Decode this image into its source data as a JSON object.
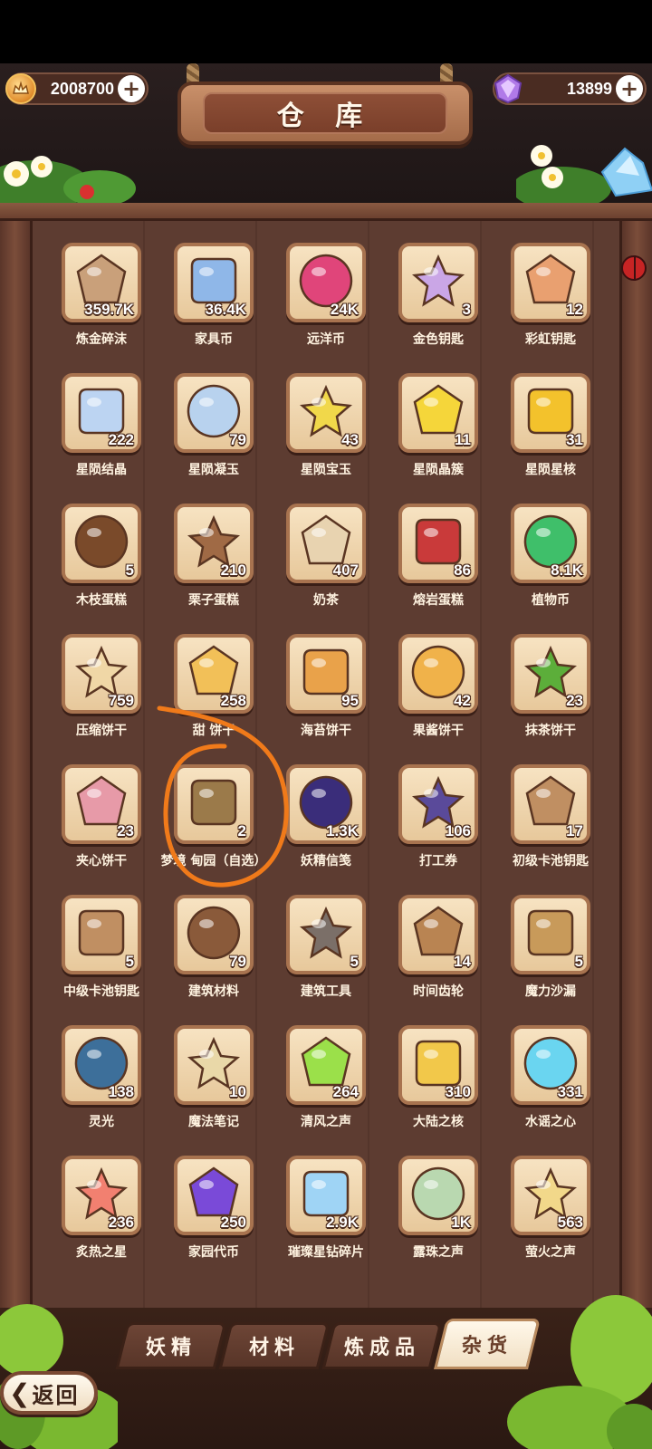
{
  "header": {
    "title": "仓 库",
    "gold": {
      "value": "2008700",
      "icon": "gold-coin-icon"
    },
    "gems": {
      "value": "13899",
      "icon": "gem-icon"
    }
  },
  "items": [
    {
      "name": "炼金碎沫",
      "count": "359.7K",
      "icon": "rock-pile-icon",
      "color": "#c9a07a"
    },
    {
      "name": "家具币",
      "count": "36.4K",
      "icon": "furniture-coin-icon",
      "color": "#8fb7e8"
    },
    {
      "name": "远洋币",
      "count": "24K",
      "icon": "ocean-coin-icon",
      "color": "#e0457a"
    },
    {
      "name": "金色钥匙",
      "count": "3",
      "icon": "golden-key-icon",
      "color": "#caa6e6"
    },
    {
      "name": "彩虹钥匙",
      "count": "12",
      "icon": "rainbow-key-icon",
      "color": "#e9a070"
    },
    {
      "name": "星陨结晶",
      "count": "222",
      "icon": "crystal-icon",
      "color": "#bcd4f2"
    },
    {
      "name": "星陨凝玉",
      "count": "79",
      "icon": "star-jade-icon",
      "color": "#b8d2ee"
    },
    {
      "name": "星陨宝玉",
      "count": "43",
      "icon": "yellow-gem-icon",
      "color": "#f1d84a"
    },
    {
      "name": "星陨晶簇",
      "count": "11",
      "icon": "yellow-star-icon",
      "color": "#f5d63a"
    },
    {
      "name": "星陨星核",
      "count": "31",
      "icon": "star-core-icon",
      "color": "#f3c22c"
    },
    {
      "name": "木枝蛋糕",
      "count": "5",
      "icon": "log-cake-icon",
      "color": "#7a4a2a"
    },
    {
      "name": "栗子蛋糕",
      "count": "210",
      "icon": "chestnut-cake-icon",
      "color": "#a06a45"
    },
    {
      "name": "奶茶",
      "count": "407",
      "icon": "milk-tea-icon",
      "color": "#e8d3b0"
    },
    {
      "name": "熔岩蛋糕",
      "count": "86",
      "icon": "lava-cake-icon",
      "color": "#c93a3a"
    },
    {
      "name": "植物币",
      "count": "8.1K",
      "icon": "plant-coin-icon",
      "color": "#3fbf6a"
    },
    {
      "name": "压缩饼干",
      "count": "759",
      "icon": "biscuit-cubes-icon",
      "color": "#f0d7a6"
    },
    {
      "name": "甜 饼干",
      "count": "258",
      "icon": "triangle-cracker-icon",
      "color": "#f2c058"
    },
    {
      "name": "海苔饼干",
      "count": "95",
      "icon": "seaweed-cracker-icon",
      "color": "#e9a24a"
    },
    {
      "name": "果酱饼干",
      "count": "42",
      "icon": "jam-cookie-icon",
      "color": "#f0b24a"
    },
    {
      "name": "抹茶饼干",
      "count": "23",
      "icon": "matcha-cookie-icon",
      "color": "#5cae3a"
    },
    {
      "name": "夹心饼干",
      "count": "23",
      "icon": "sandwich-cookie-icon",
      "color": "#e79aa8"
    },
    {
      "name": "梦境 甸园（自选）",
      "count": "2",
      "icon": "gift-box-icon",
      "color": "#9b7a4a"
    },
    {
      "name": "妖精信笺",
      "count": "1.3K",
      "icon": "fairy-card-icon",
      "color": "#3a2d7a"
    },
    {
      "name": "打工券",
      "count": "106",
      "icon": "work-ticket-icon",
      "color": "#5a4a9a"
    },
    {
      "name": "初级卡池钥匙",
      "count": "17",
      "icon": "bronze-key-icon",
      "color": "#c08f62"
    },
    {
      "name": "中级卡池钥匙",
      "count": "5",
      "icon": "silver-key-icon",
      "color": "#c08f62"
    },
    {
      "name": "建筑材料",
      "count": "79",
      "icon": "planks-rope-icon",
      "color": "#8a5a3a"
    },
    {
      "name": "建筑工具",
      "count": "5",
      "icon": "hammer-icon",
      "color": "#7b6f68"
    },
    {
      "name": "时间齿轮",
      "count": "14",
      "icon": "gears-icon",
      "color": "#b98452"
    },
    {
      "name": "魔力沙漏",
      "count": "5",
      "icon": "hourglass-compass-icon",
      "color": "#c89a5a"
    },
    {
      "name": "灵光",
      "count": "138",
      "icon": "lightbulb-stone-icon",
      "color": "#3d6f9a"
    },
    {
      "name": "魔法笔记",
      "count": "10",
      "icon": "magic-notebook-icon",
      "color": "#e9d8a8"
    },
    {
      "name": "清风之声",
      "count": "264",
      "icon": "green-leaf-gem-icon",
      "color": "#9be04a"
    },
    {
      "name": "大陆之核",
      "count": "310",
      "icon": "gold-leaf-gem-icon",
      "color": "#f2c84a"
    },
    {
      "name": "水谣之心",
      "count": "331",
      "icon": "blue-leaf-gem-icon",
      "color": "#6ad5f0"
    },
    {
      "name": "炙热之星",
      "count": "236",
      "icon": "red-leaf-gem-icon",
      "color": "#f28070"
    },
    {
      "name": "家园代币",
      "count": "250",
      "icon": "purple-star-coin-icon",
      "color": "#7a4ad8"
    },
    {
      "name": "璀璨星钻碎片",
      "count": "2.9K",
      "icon": "diamond-shards-icon",
      "color": "#9fd4f5"
    },
    {
      "name": "露珠之声",
      "count": "1K",
      "icon": "bottle-plant-icon",
      "color": "#b9d8b0"
    },
    {
      "name": "萤火之声",
      "count": "563",
      "icon": "bottle-light-icon",
      "color": "#f2d88a"
    }
  ],
  "tabs": [
    {
      "label": "妖精",
      "active": false
    },
    {
      "label": "材料",
      "active": false
    },
    {
      "label": "炼成品",
      "active": false
    },
    {
      "label": "杂货",
      "active": true
    }
  ],
  "back_button": {
    "label": "返回",
    "icon": "chevron-left-icon"
  },
  "colors": {
    "panel": "#5d3c31",
    "tile": "#f3dcb8",
    "tile_border": "#a8734f",
    "annotation": "#f07a1a"
  }
}
